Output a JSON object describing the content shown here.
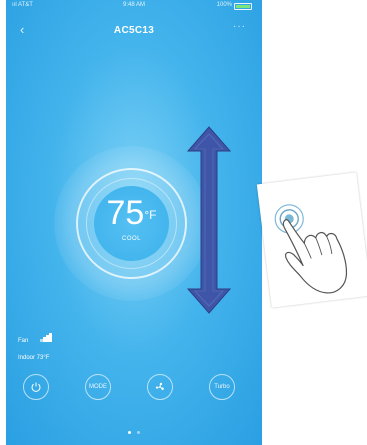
{
  "status_bar": {
    "carrier": "ııl AT&T",
    "time": "9:48 AM",
    "battery": "100%"
  },
  "header": {
    "title": "AC5C13",
    "back_icon": "chevron-left-icon",
    "more_icon": "more-dots-icon"
  },
  "thermostat": {
    "temperature": "75",
    "unit": "°F",
    "mode": "COOL"
  },
  "info": {
    "fan_label": "Fan",
    "fan_level_fraction": 0.75,
    "indoor_label": "Indoor 73°F"
  },
  "controls": [
    {
      "icon": "power-icon",
      "label": ""
    },
    {
      "icon": "mode-icon",
      "label": "MODE"
    },
    {
      "icon": "fan-icon",
      "label": ""
    },
    {
      "icon": "turbo-icon",
      "label": "Turbo"
    }
  ],
  "pagination": {
    "pages": 2,
    "current": 1
  },
  "overlay": {
    "arrow": "double-arrow-vertical",
    "arrow_color": "#3f56a8",
    "gesture": "hand-tap-icon"
  }
}
